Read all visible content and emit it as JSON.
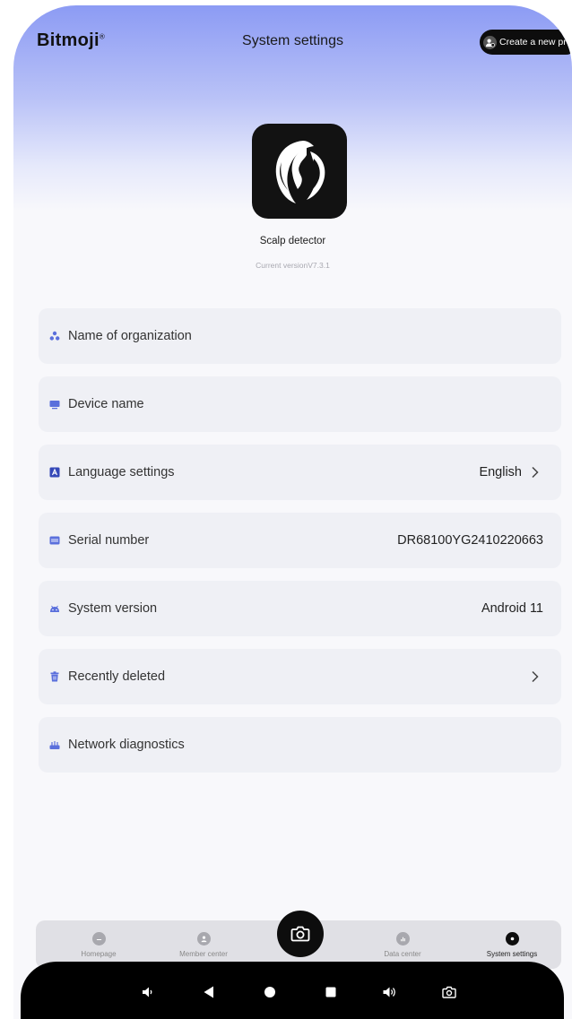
{
  "header": {
    "logo": "Bitmoji",
    "logo_mark": "®",
    "title": "System settings",
    "create_profile_label": "Create a new profile"
  },
  "app": {
    "name": "Scalp detector",
    "version": "Current versionV7.3.1"
  },
  "settings": [
    {
      "label": "Name of organization",
      "value": "",
      "chevron": false,
      "icon": "people-icon"
    },
    {
      "label": "Device name",
      "value": "",
      "chevron": false,
      "icon": "monitor-icon"
    },
    {
      "label": "Language settings",
      "value": "English",
      "chevron": true,
      "icon": "language-icon"
    },
    {
      "label": "Serial number",
      "value": "DR68100YG2410220663",
      "chevron": false,
      "icon": "serial-icon"
    },
    {
      "label": "System version",
      "value": "Android 11",
      "chevron": false,
      "icon": "android-icon"
    },
    {
      "label": "Recently deleted",
      "value": "",
      "chevron": true,
      "icon": "trash-icon"
    },
    {
      "label": "Network diagnostics",
      "value": "",
      "chevron": false,
      "icon": "network-icon"
    }
  ],
  "tabs": [
    {
      "label": "Homepage"
    },
    {
      "label": "Member center"
    },
    {
      "label": "Data center"
    },
    {
      "label": "System settings"
    }
  ],
  "colors": {
    "accent": "#8c9bf4",
    "icon_blue": "#5a6fdc",
    "dark": "#0d0d0d"
  }
}
